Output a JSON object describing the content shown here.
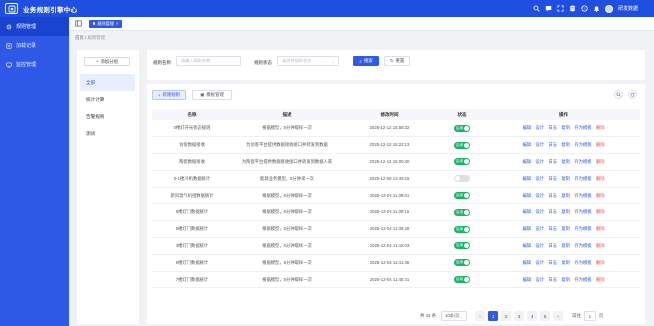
{
  "app": {
    "title": "业务规则引擎中心",
    "username": "研发数据"
  },
  "header_icons": [
    "search-icon",
    "message-icon",
    "fullscreen-icon",
    "document-icon",
    "help-icon",
    "bell-icon"
  ],
  "sidebar": {
    "items": [
      {
        "label": "规则管理",
        "icon": "gear-icon",
        "active": true
      },
      {
        "label": "加载记录",
        "icon": "record-icon",
        "active": false
      },
      {
        "label": "监控管理",
        "icon": "monitor-icon",
        "active": false
      }
    ]
  },
  "subbar": {
    "tag_label": "规则管理"
  },
  "breadcrumb": {
    "home": "首页",
    "sep": "/",
    "current": "规则管理"
  },
  "groups": {
    "add_label": "添加分组",
    "items": [
      {
        "label": "全部",
        "active": true
      },
      {
        "label": "统计计算",
        "active": false
      },
      {
        "label": "告警规则",
        "active": false
      },
      {
        "label": "测试",
        "active": false
      }
    ]
  },
  "filter": {
    "name_label": "规则名称",
    "name_placeholder": "请输入规则名称",
    "status_label": "规则状态",
    "status_placeholder": "请选择规则状态",
    "search_label": "搜索",
    "reset_label": "重置"
  },
  "actions": {
    "create_label": "新建规则",
    "template_label": "模板管理"
  },
  "table": {
    "headers": [
      "名称",
      "描述",
      "修改时间",
      "状态",
      "操作"
    ],
    "op_labels": [
      "编辑",
      "设计",
      "日志",
      "复制",
      "存为模板",
      "删除"
    ],
    "switch_on_text": "启用",
    "switch_off_text": "",
    "rows": [
      {
        "name": "0楼灯开光状态规则",
        "desc": "根据模型，5分钟取样一次",
        "time": "2025-12-12 15:58:32",
        "on": true
      },
      {
        "name": "访客数据接收",
        "desc": "为访客平台提供数据接收接口并转发到数据",
        "time": "2025-12-12 15:22:13",
        "on": true
      },
      {
        "name": "陶瓷数据接收",
        "desc": "为陶瓷平台提供数据接收接口并转发到数据人来",
        "time": "2025-12-12 15:00:40",
        "on": true
      },
      {
        "name": "0-1楼冷机数据统计",
        "desc": "能源业务模型，5分钟采一次",
        "time": "2025-12-09 13:49:15",
        "on": false
      },
      {
        "name": "新风温气机组数据统计",
        "desc": "根据模型，5分钟取样一次",
        "time": "2025-12-04 11:39:01",
        "on": true
      },
      {
        "name": "6楼灯门数据统计",
        "desc": "根据模型，5分钟取样一次",
        "time": "2025-12-04 11:39:15",
        "on": true
      },
      {
        "name": "5楼灯门数据统计",
        "desc": "根据模型，5分钟取样一次",
        "time": "2025-12-04 11:39:29",
        "on": true
      },
      {
        "name": "3楼灯门数据统计",
        "desc": "根据模型，5分钟取样一次",
        "time": "2025-12-04 11:42:03",
        "on": true
      },
      {
        "name": "8楼灯门数据统计",
        "desc": "根据模型，5分钟取样一次",
        "time": "2025-12-04 11:41:46",
        "on": true
      },
      {
        "name": "7楼灯门数据统计",
        "desc": "根据模型，5分钟取样一次",
        "time": "2025-12-04 11:40:41",
        "on": true
      }
    ]
  },
  "pagination": {
    "total_label": "共 43 条",
    "page_size": "10条/页",
    "pages": [
      "1",
      "2",
      "3",
      "4",
      "5"
    ],
    "current_page": "1",
    "goto_label": "前往",
    "goto_value": "1",
    "page_unit": "页",
    "prev": "‹",
    "next": "›"
  },
  "colors": {
    "primary": "#2f5be8",
    "sidebar": "#2d59e6",
    "danger": "#f5483b",
    "success": "#18b566"
  }
}
